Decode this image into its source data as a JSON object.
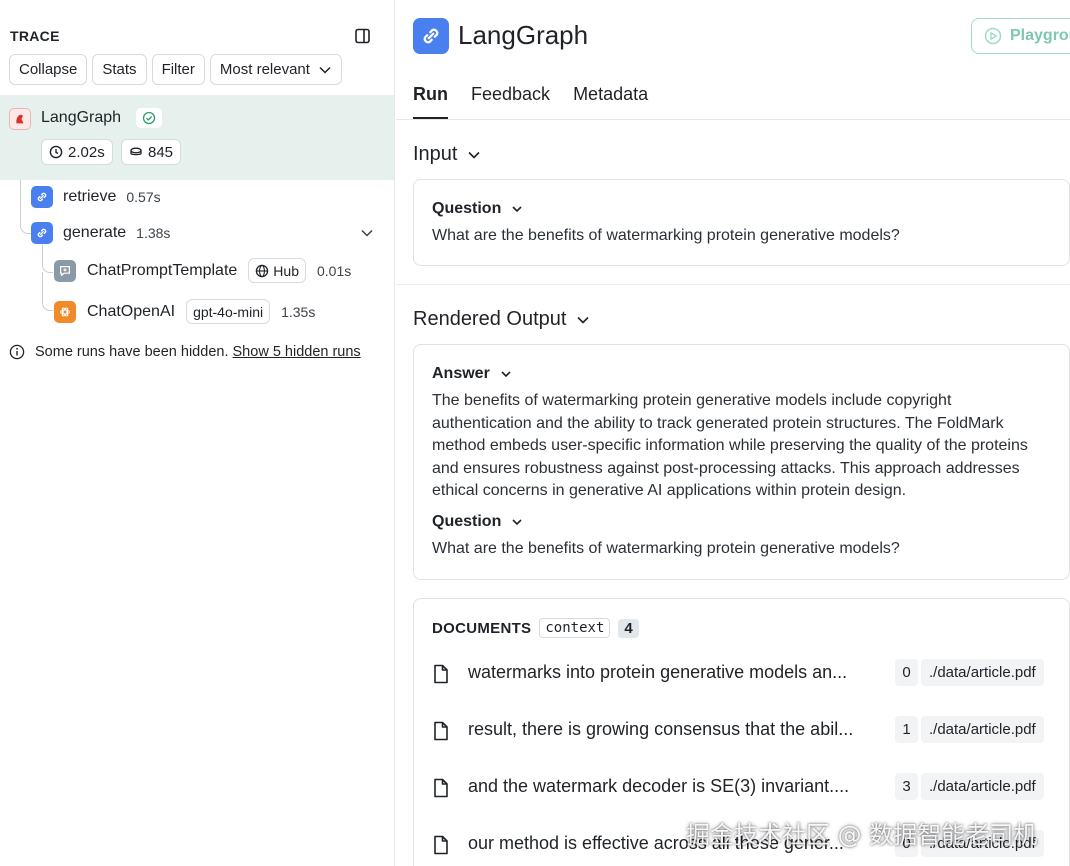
{
  "trace": {
    "title": "TRACE",
    "toolbar": {
      "collapse": "Collapse",
      "stats": "Stats",
      "filter": "Filter",
      "sort": "Most relevant"
    },
    "root": {
      "name": "LangGraph",
      "status": "success",
      "latency": "2.02s",
      "tokens": "845"
    },
    "runs": [
      {
        "name": "retrieve",
        "time": "0.57s",
        "icon": "chain-link-icon"
      },
      {
        "name": "generate",
        "time": "1.38s",
        "icon": "chain-link-icon"
      }
    ],
    "children": [
      {
        "name": "ChatPromptTemplate",
        "tag": "Hub",
        "time": "0.01s",
        "icon": "prompt-icon"
      },
      {
        "name": "ChatOpenAI",
        "tag": "gpt-4o-mini",
        "time": "1.35s",
        "icon": "openai-icon"
      }
    ],
    "hidden_note": "Some runs have been hidden.",
    "hidden_link": "Show 5 hidden runs"
  },
  "header": {
    "title": "LangGraph",
    "playground": "Playgrou"
  },
  "tabs": [
    {
      "label": "Run",
      "active": true
    },
    {
      "label": "Feedback",
      "active": false
    },
    {
      "label": "Metadata",
      "active": false
    }
  ],
  "input": {
    "title": "Input",
    "question_label": "Question",
    "question": "What are the benefits of watermarking protein generative models?"
  },
  "output": {
    "title": "Rendered Output",
    "answer_label": "Answer",
    "answer": "The benefits of watermarking protein generative models include copyright authentication and the ability to track generated protein structures. The FoldMark method embeds user-specific information while preserving the quality of the proteins and ensures robustness against post-processing attacks. This approach addresses ethical concerns in generative AI applications within protein design.",
    "question_label": "Question",
    "question": "What are the benefits of watermarking protein generative models?"
  },
  "documents": {
    "title": "DOCUMENTS",
    "key": "context",
    "count": "4",
    "items": [
      {
        "text": "watermarks into protein generative models an...",
        "index": "0",
        "source": "./data/article.pdf"
      },
      {
        "text": "result, there is growing consensus that the abil...",
        "index": "1",
        "source": "./data/article.pdf"
      },
      {
        "text": "and the watermark decoder is SE(3) invariant....",
        "index": "3",
        "source": "./data/article.pdf"
      },
      {
        "text": "our method is effective across all these gener...",
        "index": "0",
        "source": "./data/article.pdf"
      }
    ]
  },
  "watermark": "掘金技术社区 @ 数据智能老司机",
  "colors": {
    "selected_row_bg": "#e6f0ec",
    "chain_icon_bg": "#4a7ff0",
    "openai_icon_bg": "#f08a2b",
    "prompt_icon_bg": "#8a9aa6",
    "success_green": "#2e9d6a",
    "playground_border": "#9fdcc5"
  }
}
